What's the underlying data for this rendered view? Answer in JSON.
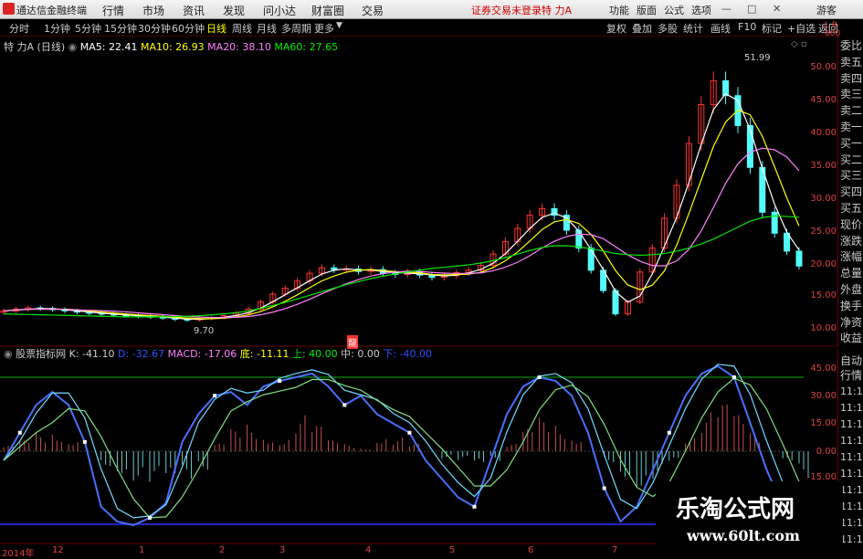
{
  "titlebar": {
    "app_title": "通达信金融终端",
    "menus": [
      "行情",
      "市场",
      "资讯",
      "发现",
      "问小达",
      "财富圈",
      "交易"
    ],
    "notice": "证券交易未登录",
    "stock": "特 力A",
    "right_menus": [
      "功能",
      "版面",
      "公式",
      "选项"
    ],
    "guest": "游客"
  },
  "periodbar": {
    "periods": [
      "分时",
      "1分钟",
      "5分钟",
      "15分钟",
      "30分钟",
      "60分钟",
      "日线",
      "周线",
      "月线",
      "多周期",
      "更多"
    ],
    "active": "日线",
    "tools": [
      "复权",
      "叠加",
      "多股",
      "统计",
      "画线",
      "F10",
      "标记",
      "+自选",
      "返回"
    ]
  },
  "main_legend": {
    "name": "特 力A",
    "period": "(日线)",
    "ma5": "MA5: 22.41",
    "ma10": "MA10: 26.93",
    "ma20": "MA20: 38.10",
    "ma60": "MA60: 27.65",
    "high_label": "51.99",
    "low_label": "9.70",
    "marker": "龍"
  },
  "sub_legend": {
    "name": "股票指标网",
    "k": "K: -41.10",
    "d": "D: -32.67",
    "macd": "MACD: -17.06",
    "di": "底: -11.11",
    "shang": "上: 40.00",
    "zhong": "中: 0.00",
    "xia": "下: -40.00"
  },
  "right_panel": {
    "items": [
      "委比",
      "卖五",
      "卖四",
      "卖三",
      "卖二",
      "卖一",
      "买一",
      "买二",
      "买三",
      "买四",
      "买五",
      "现价",
      "涨跌",
      "涨幅",
      "总量",
      "外盘",
      "换手",
      "净资",
      "收益"
    ],
    "sub_items": [
      "自动",
      "行情"
    ],
    "times": [
      "11:1",
      "11:1",
      "11:1",
      "11:1",
      "11:1",
      "11:1",
      "11:1",
      "11:1",
      "11:1",
      "11:1"
    ]
  },
  "y_axis_main": [
    "50.00",
    "45.00",
    "40.00",
    "35.00",
    "30.00",
    "25.00",
    "20.00",
    "15.00",
    "10.00"
  ],
  "y_axis_sub": [
    "45.00",
    "30.00",
    "15.00",
    "0.00",
    "-15.00"
  ],
  "x_axis": [
    "2014年",
    "12",
    "1",
    "2",
    "3",
    "4",
    "5",
    "6",
    "7"
  ],
  "watermark": {
    "cn": "乐淘公式网",
    "url": "www.60lt.com"
  },
  "colors": {
    "up": "#ff3232",
    "down": "#54fcfc",
    "ma5": "#ffffff",
    "ma10": "#ffff00",
    "ma20": "#ff80ff",
    "ma60": "#00e600"
  },
  "chart_data": {
    "type": "line",
    "title": "特 力A (日线)",
    "ylim": [
      9,
      53
    ],
    "close": [
      12.0,
      12.3,
      12.5,
      12.4,
      12.2,
      12.0,
      11.8,
      11.6,
      11.5,
      11.3,
      11.2,
      11.1,
      11.0,
      10.8,
      10.6,
      10.5,
      10.7,
      10.9,
      11.2,
      11.6,
      12.3,
      13.5,
      14.8,
      15.8,
      17.0,
      18.3,
      19.2,
      18.9,
      19.0,
      18.6,
      18.9,
      18.3,
      18.1,
      18.5,
      18.0,
      17.6,
      17.9,
      18.4,
      18.8,
      19.6,
      21.5,
      23.6,
      25.8,
      28.0,
      29.1,
      28.0,
      25.5,
      22.5,
      18.8,
      15.4,
      11.5,
      13.5,
      18.5,
      22.5,
      27.5,
      33.0,
      40.0,
      46.5,
      50.5,
      48.0,
      43.0,
      36.0,
      28.5,
      25.0,
      22.0,
      19.5
    ],
    "ma60": [
      11.5,
      11.45,
      11.4,
      11.35,
      11.3,
      11.25,
      11.2,
      11.15,
      11.1,
      11.05,
      11.0,
      11.0,
      11.0,
      11.0,
      11.05,
      11.1,
      11.2,
      11.35,
      11.5,
      11.7,
      12.0,
      12.4,
      12.9,
      13.4,
      14.0,
      14.6,
      15.2,
      15.8,
      16.4,
      16.9,
      17.4,
      17.8,
      18.2,
      18.5,
      18.8,
      19.1,
      19.3,
      19.5,
      19.7,
      20.0,
      20.4,
      20.9,
      21.5,
      22.1,
      22.6,
      22.9,
      22.9,
      22.7,
      22.4,
      22.0,
      21.6,
      21.4,
      21.3,
      21.4,
      21.6,
      22.0,
      22.5,
      23.2,
      24.0,
      25.0,
      26.0,
      27.0,
      27.6,
      27.9,
      27.8,
      27.65
    ],
    "kdj_k": [
      -5,
      10,
      25,
      32,
      25,
      5,
      -30,
      -38,
      -40,
      -36,
      -28,
      5,
      20,
      30,
      32,
      25,
      35,
      38,
      40,
      42,
      35,
      25,
      30,
      20,
      15,
      10,
      -5,
      -15,
      -25,
      -30,
      -5,
      20,
      35,
      40,
      38,
      30,
      10,
      -20,
      -38,
      -30,
      -10,
      10,
      30,
      42,
      46,
      40,
      15,
      -10,
      -30,
      -41
    ],
    "macd_hist": [
      3,
      6,
      10,
      12,
      8,
      0,
      -8,
      -12,
      -16,
      -20,
      -22,
      -18,
      -10,
      4,
      12,
      16,
      10,
      8,
      20,
      14,
      6,
      4,
      2,
      10,
      8,
      4,
      0,
      -4,
      -6,
      -10,
      -6,
      4,
      12,
      18,
      16,
      10,
      0,
      -6,
      -14,
      -20,
      -16,
      -8,
      10,
      22,
      26,
      20,
      10,
      0,
      -8,
      -16
    ]
  }
}
